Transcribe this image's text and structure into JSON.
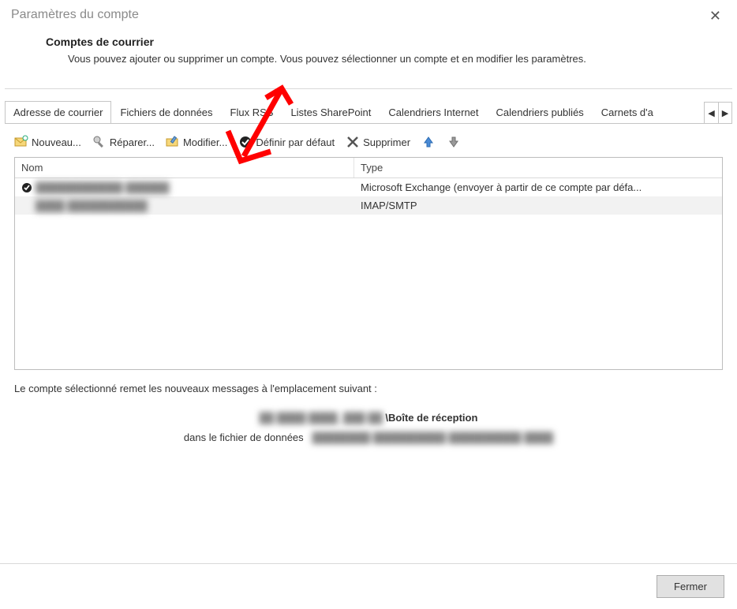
{
  "window": {
    "title": "Paramètres du compte"
  },
  "header": {
    "title": "Comptes de courrier",
    "desc": "Vous pouvez ajouter ou supprimer un compte. Vous pouvez sélectionner un compte et en modifier les paramètres."
  },
  "tabs": {
    "items": [
      "Adresse de courrier",
      "Fichiers de données",
      "Flux RSS",
      "Listes SharePoint",
      "Calendriers Internet",
      "Calendriers publiés",
      "Carnets d'a"
    ],
    "active_index": 0
  },
  "toolbar": {
    "new": "Nouveau...",
    "repair": "Réparer...",
    "modify": "Modifier...",
    "default": "Définir par défaut",
    "delete": "Supprimer"
  },
  "list": {
    "columns": {
      "name": "Nom",
      "type": "Type"
    },
    "rows": [
      {
        "is_default": true,
        "name_masked": "████████████ ██████",
        "type": "Microsoft Exchange (envoyer à partir de ce compte par défa..."
      },
      {
        "is_default": false,
        "name_masked": "████ ███████████",
        "type": "IMAP/SMTP"
      }
    ]
  },
  "delivery": {
    "intro": "Le compte sélectionné remet les nouveaux messages à l'emplacement suivant :",
    "path_masked": "██ ████ ████_███ ██ ",
    "path_suffix_bold": "\\Boîte de réception",
    "file_label": "dans le fichier de données",
    "file_masked": "████████  ██████████  ██████████ ████"
  },
  "footer": {
    "close": "Fermer"
  }
}
